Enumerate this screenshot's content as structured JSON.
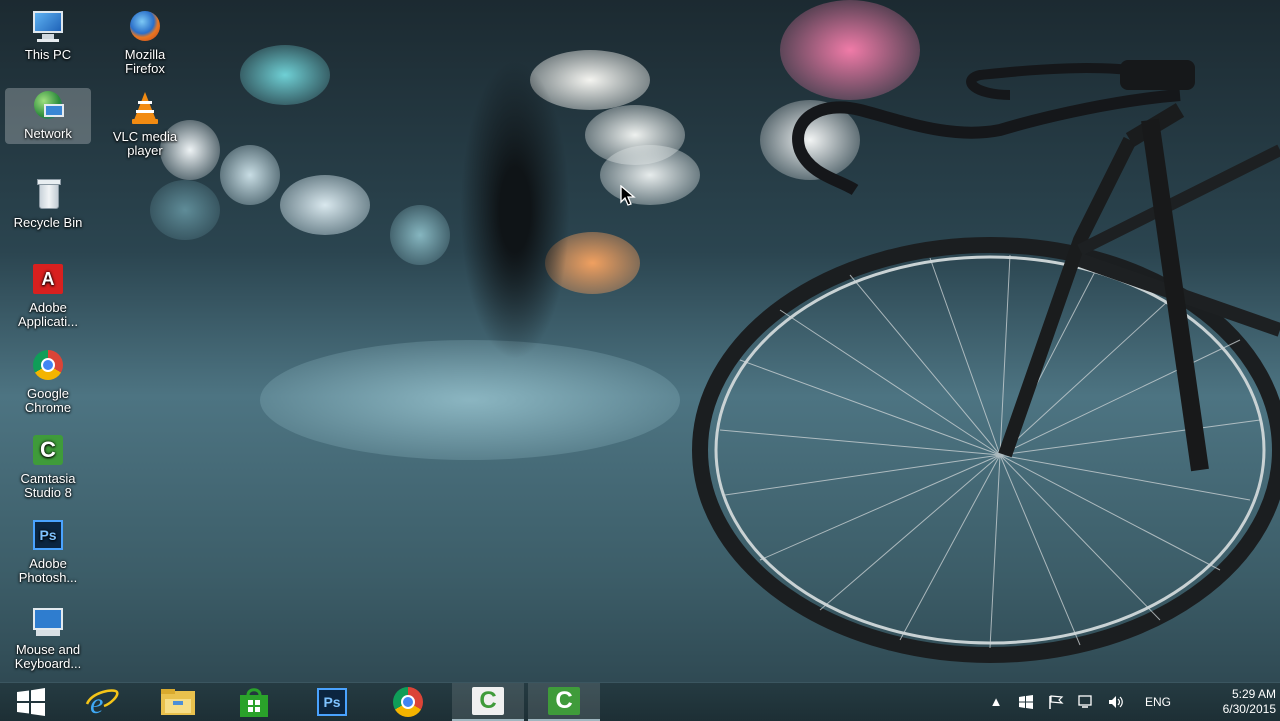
{
  "desktop": {
    "icons": [
      {
        "label": "This PC",
        "icon": "this-pc-icon"
      },
      {
        "label": "Mozilla\nFirefox",
        "icon": "firefox-icon"
      },
      {
        "label": "Network",
        "icon": "network-icon"
      },
      {
        "label": "VLC media\nplayer",
        "icon": "vlc-icon"
      },
      {
        "label": "Recycle Bin",
        "icon": "recycle-bin-icon"
      },
      {
        "label": "Adobe\nApplicati...",
        "icon": "adobe-application-manager-icon"
      },
      {
        "label": "Google\nChrome",
        "icon": "chrome-icon"
      },
      {
        "label": "Camtasia\nStudio 8",
        "icon": "camtasia-icon"
      },
      {
        "label": "Adobe\nPhotosh...",
        "icon": "photoshop-icon"
      },
      {
        "label": "Mouse and\nKeyboard...",
        "icon": "mouse-keyboard-icon"
      }
    ]
  },
  "taskbar": {
    "pinned": [
      "start-icon",
      "internet-explorer-icon",
      "file-explorer-icon",
      "store-icon",
      "photoshop-icon",
      "chrome-icon",
      "camtasia-recorder-icon",
      "camtasia-studio-icon"
    ],
    "photoshop_label": "Ps",
    "tray": {
      "language": "ENG",
      "time": "5:29 AM",
      "date": "6/30/2015"
    }
  },
  "colors": {
    "taskbar": "#1d2f35",
    "camtasia_green": "#3f9b3a",
    "photoshop_blue": "#2f5e9e"
  }
}
